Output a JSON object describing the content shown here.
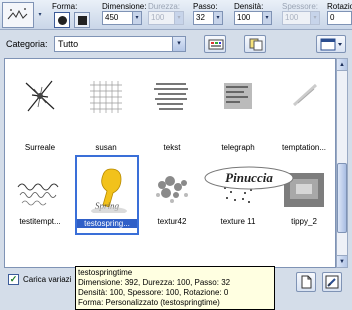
{
  "toolbar": {
    "forma_label": "Forma:",
    "dimensione_label": "Dimensione:",
    "dimensione_value": "450",
    "durezza_label": "Durezza:",
    "durezza_value": "100",
    "passo_label": "Passo:",
    "passo_value": "32",
    "densita_label": "Densità:",
    "densita_value": "100",
    "spessore_label": "Spessore:",
    "spessore_value": "100",
    "rotazione_label": "Rotazion",
    "rotazione_value": "0"
  },
  "category": {
    "label": "Categoria:",
    "selected": "Tutto"
  },
  "brushes": [
    {
      "name": "Surreale",
      "icon": "surreal-brush-thumb"
    },
    {
      "name": "susan",
      "icon": "grid-brush-thumb"
    },
    {
      "name": "tekst",
      "icon": "text-brush-thumb"
    },
    {
      "name": "telegraph",
      "icon": "telegraph-brush-thumb"
    },
    {
      "name": "temptation...",
      "icon": "temptation-brush-thumb"
    },
    {
      "name": "testitempt...",
      "icon": "handwriting-brush-thumb"
    },
    {
      "name": "testospring...",
      "icon": "springtime-brush-thumb"
    },
    {
      "name": "textur42",
      "icon": "texture-brush-thumb"
    },
    {
      "name": "texture 11",
      "icon": "texture11-brush-thumb"
    },
    {
      "name": "tippy_2",
      "icon": "tippy-brush-thumb"
    }
  ],
  "watermark": "Pinuccia",
  "bottom": {
    "checkbox_label": "Carica variazi"
  },
  "tooltip": {
    "line1": "testospringtime",
    "line2": "Dimensione: 392, Durezza: 100, Passo: 32",
    "line3": "Densità: 100, Spessore: 100, Rotazione: 0",
    "line4": "Forma: Personalizzato (testospringtime)"
  },
  "colors": {
    "accent": "#3a6fd8",
    "selection": "#2f5fc7",
    "tooltip_bg": "#ffffe1"
  }
}
